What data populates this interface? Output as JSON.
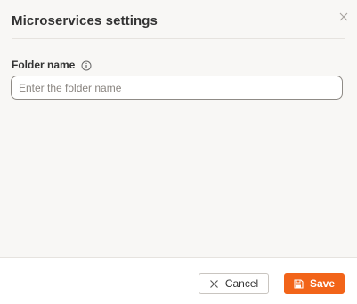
{
  "dialog": {
    "title": "Microservices settings"
  },
  "form": {
    "folder_label": "Folder name",
    "folder_input": {
      "value": "",
      "placeholder": "Enter the folder name"
    }
  },
  "footer": {
    "cancel_label": "Cancel",
    "save_label": "Save"
  },
  "icons": {
    "close": "close-icon",
    "info": "info-icon",
    "cancel": "x-icon",
    "save": "floppy-disk-icon"
  },
  "colors": {
    "accent": "#f26419",
    "body_background": "#f8f7f5"
  }
}
